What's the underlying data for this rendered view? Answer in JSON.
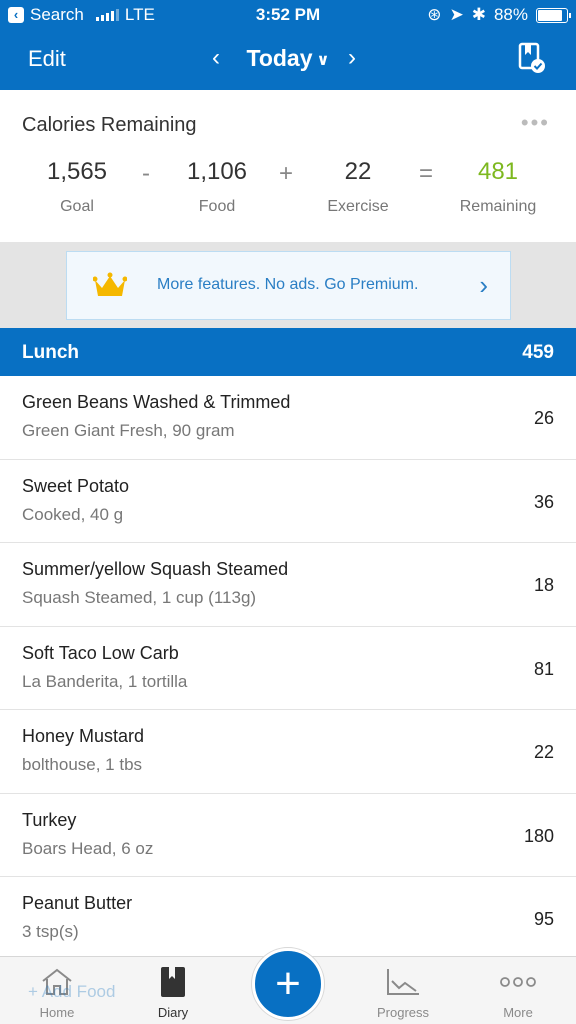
{
  "status_bar": {
    "back_app": "Search",
    "carrier": "LTE",
    "time": "3:52 PM",
    "battery": "88%",
    "battery_level": 0.88
  },
  "nav": {
    "edit_label": "Edit",
    "title": "Today",
    "prev_icon": "chevron-left-icon",
    "next_icon": "chevron-right-icon"
  },
  "calories": {
    "heading": "Calories Remaining",
    "goal": {
      "value": "1,565",
      "label": "Goal"
    },
    "minus": "-",
    "food": {
      "value": "1,106",
      "label": "Food"
    },
    "plus": "+",
    "exercise": {
      "value": "22",
      "label": "Exercise"
    },
    "equals": "=",
    "remaining": {
      "value": "481",
      "label": "Remaining"
    },
    "remaining_color": "#7db81f"
  },
  "promo": {
    "text": "More features. No ads. Go Premium."
  },
  "meal": {
    "name": "Lunch",
    "total": "459",
    "items": [
      {
        "name": "Green Beans Washed & Trimmed",
        "desc": "Green Giant Fresh, 90 gram",
        "cal": "26"
      },
      {
        "name": "Sweet Potato",
        "desc": "Cooked, 40 g",
        "cal": "36"
      },
      {
        "name": "Summer/yellow Squash Steamed",
        "desc": "Squash Steamed, 1 cup (113g)",
        "cal": "18"
      },
      {
        "name": "Soft Taco Low Carb",
        "desc": "La Banderita, 1 tortilla",
        "cal": "81"
      },
      {
        "name": "Honey Mustard",
        "desc": "bolthouse, 1 tbs",
        "cal": "22"
      },
      {
        "name": "Turkey",
        "desc": "Boars Head, 6 oz",
        "cal": "180"
      },
      {
        "name": "Peanut Butter",
        "desc": "3 tsp(s)",
        "cal": "95"
      }
    ],
    "add_food": "+ Add Food"
  },
  "tabs": {
    "home": "Home",
    "diary": "Diary",
    "progress": "Progress",
    "more": "More"
  },
  "colors": {
    "brand_blue": "#0870c3",
    "link_blue": "#2a7ec4"
  }
}
